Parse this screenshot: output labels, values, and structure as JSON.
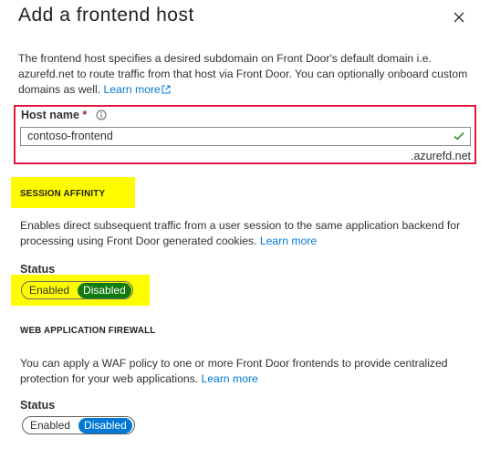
{
  "panel": {
    "title": "Add a frontend host",
    "description": "The frontend host specifies a desired subdomain on Front Door's default domain i.e. azurefd.net to route traffic from that host via Front Door. You can optionally onboard custom domains as well.",
    "learn_more": "Learn more"
  },
  "host": {
    "label": "Host name",
    "required_mark": "*",
    "value": "contoso-frontend",
    "suffix": ".azurefd.net"
  },
  "session_affinity": {
    "heading": "SESSION AFFINITY",
    "description_line1": "Enables direct subsequent traffic from a user session to the same application backend for",
    "description_line2": "processing using Front Door generated cookies.",
    "learn_more": "Learn more",
    "status_label": "Status",
    "option_enabled": "Enabled",
    "option_disabled": "Disabled",
    "selected": "Disabled",
    "selected_color": "#107c10"
  },
  "waf": {
    "heading": "WEB APPLICATION FIREWALL",
    "description_line1": "You can apply a WAF policy to one or more Front Door frontends to provide centralized",
    "description_line2": "protection for your web applications.",
    "learn_more": "Learn more",
    "status_label": "Status",
    "option_enabled": "Enabled",
    "option_disabled": "Disabled",
    "selected": "Disabled",
    "selected_color": "#0078d4"
  },
  "colors": {
    "highlight": "#fffc00",
    "error_border": "#e3173e",
    "link": "#0078d4",
    "valid_check": "#107c10"
  }
}
